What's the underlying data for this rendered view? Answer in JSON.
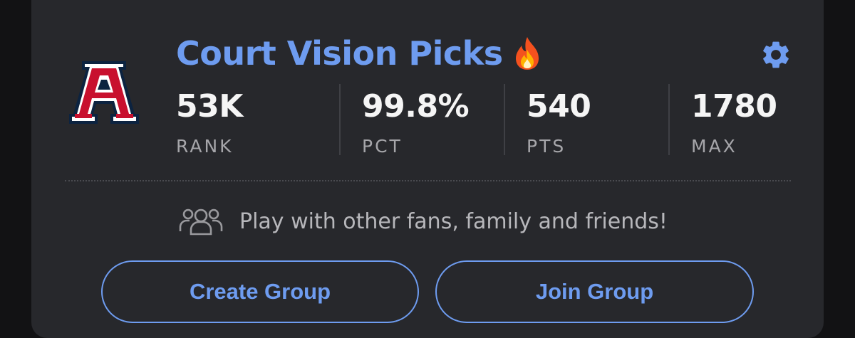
{
  "header": {
    "title": "Court Vision Picks",
    "title_icon": "fire-icon",
    "settings_icon": "gear-icon",
    "logo": {
      "name": "team-logo",
      "letter": "A"
    }
  },
  "stats": [
    {
      "value": "53K",
      "label": "RANK"
    },
    {
      "value": "99.8%",
      "label": "PCT"
    },
    {
      "value": "540",
      "label": "PTS"
    },
    {
      "value": "1780",
      "label": "MAX"
    }
  ],
  "invite": {
    "icon": "group-icon",
    "text": "Play with other fans, family and friends!"
  },
  "buttons": {
    "create_label": "Create Group",
    "join_label": "Join Group"
  },
  "colors": {
    "accent": "#6e9cf0",
    "card_bg": "#27282c",
    "page_bg": "#121214",
    "logo_red": "#c8102e",
    "logo_navy": "#0c2340"
  }
}
